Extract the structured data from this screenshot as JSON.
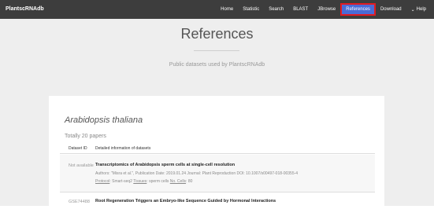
{
  "navbar": {
    "brand": "PlantscRNAdb",
    "items": [
      {
        "label": "Home"
      },
      {
        "label": "Statistic"
      },
      {
        "label": "Search"
      },
      {
        "label": "BLAST"
      },
      {
        "label": "JBrowse"
      },
      {
        "label": "References"
      },
      {
        "label": "Download"
      },
      {
        "label": "Help"
      }
    ],
    "active_item": "References"
  },
  "page": {
    "title": "References",
    "subtitle": "Public datasets used by PlantscRNAdb"
  },
  "section": {
    "species": "Arabidopsis thaliana",
    "count": "Totally 20 papers",
    "columns": [
      "Dataset ID",
      "Detailed information of datasets"
    ],
    "rows": [
      {
        "dataset_id": "Not available",
        "title": "Transcriptomics of Arabidopsis sperm cells at single-cell resolution",
        "authors": "Authors: \"Misra et al.\", Publication Date: 2019.01.24 Journal: Plant Reproduction DOI: 10.1007/s00497-018-00355-4",
        "protocol_label": "Protocol",
        "protocol_value": ": Smart-seq2 ",
        "tissues_label": "Tissues",
        "tissues_value": ": sperm cells ",
        "cells_label": "No. Cells",
        "cells_value": ": 80"
      },
      {
        "dataset_id": "GSE74488",
        "title": "Root Regeneration Triggers an Embryo-like Sequence Guided by Hormonal Interactions"
      }
    ]
  },
  "colors": {
    "navbar_bg": "#3d3d3d",
    "active_bg": "#4a6bd6",
    "active_border": "#e11b22",
    "page_bg": "#eeeeee"
  }
}
